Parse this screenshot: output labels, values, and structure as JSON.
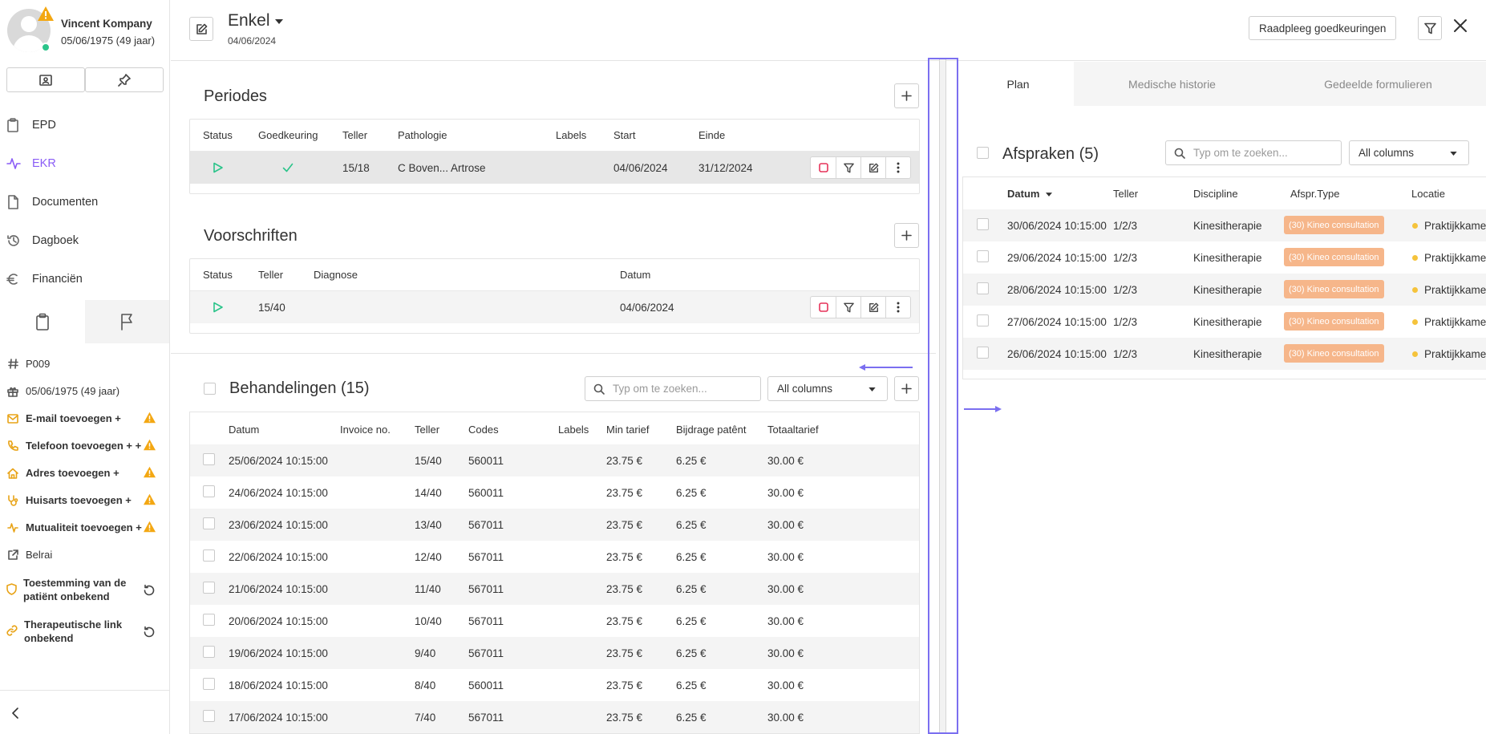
{
  "patient": {
    "name": "Vincent Kompany",
    "dob": "05/06/1975 (49 jaar)"
  },
  "nav": [
    {
      "label": "EPD",
      "icon": "clipboard-icon"
    },
    {
      "label": "EKR",
      "icon": "activity-icon"
    },
    {
      "label": "Documenten",
      "icon": "document-icon"
    },
    {
      "label": "Dagboek",
      "icon": "history-icon"
    },
    {
      "label": "Financiën",
      "icon": "euro-icon"
    }
  ],
  "info": [
    {
      "label": "P009",
      "icon": "hash-icon"
    },
    {
      "label": "05/06/1975 (49 jaar)",
      "icon": "gift-icon"
    },
    {
      "label": "E-mail toevoegen +",
      "icon": "mail-icon"
    },
    {
      "label": "Telefoon toevoegen + +",
      "icon": "phone-icon"
    },
    {
      "label": "Adres toevoegen +",
      "icon": "home-icon"
    },
    {
      "label": "Huisarts toevoegen +",
      "icon": "stethoscope-icon"
    },
    {
      "label": "Mutualiteit toevoegen +",
      "icon": "activity-icon"
    },
    {
      "label": "Belrai",
      "icon": "external-link-icon"
    },
    {
      "label": "Toestemming van de patiënt onbekend",
      "icon": "shield-icon"
    },
    {
      "label": "Therapeutische link onbekend",
      "icon": "link-icon"
    }
  ],
  "header": {
    "title": "Enkel",
    "date": "04/06/2024",
    "consult_button": "Raadpleeg goedkeuringen"
  },
  "periodes": {
    "title": "Periodes",
    "columns": [
      "Status",
      "Goedkeuring",
      "Teller",
      "Pathologie",
      "Labels",
      "Start",
      "Einde"
    ],
    "rows": [
      {
        "teller": "15/18",
        "pathologie": "C Boven... Artrose",
        "labels": "",
        "start": "04/06/2024",
        "einde": "31/12/2024"
      }
    ]
  },
  "voorschriften": {
    "title": "Voorschriften",
    "columns": [
      "Status",
      "Teller",
      "Diagnose",
      "Datum"
    ],
    "rows": [
      {
        "teller": "15/40",
        "diagnose": "",
        "datum": "04/06/2024"
      }
    ]
  },
  "behandelingen": {
    "title": "Behandelingen (15)",
    "search_placeholder": "Typ om te zoeken...",
    "filter_value": "All columns",
    "columns": [
      "Datum",
      "Invoice no.",
      "Teller",
      "Codes",
      "Labels",
      "Min tarief",
      "Bijdrage patênt",
      "Totaaltarief"
    ],
    "rows": [
      {
        "datum": "25/06/2024 10:15:00",
        "invoice": "",
        "teller": "15/40",
        "codes": "560011",
        "labels": "",
        "min": "23.75 €",
        "bijdrage": "6.25 €",
        "totaal": "30.00 €"
      },
      {
        "datum": "24/06/2024 10:15:00",
        "invoice": "",
        "teller": "14/40",
        "codes": "560011",
        "labels": "",
        "min": "23.75 €",
        "bijdrage": "6.25 €",
        "totaal": "30.00 €"
      },
      {
        "datum": "23/06/2024 10:15:00",
        "invoice": "",
        "teller": "13/40",
        "codes": "567011",
        "labels": "",
        "min": "23.75 €",
        "bijdrage": "6.25 €",
        "totaal": "30.00 €"
      },
      {
        "datum": "22/06/2024 10:15:00",
        "invoice": "",
        "teller": "12/40",
        "codes": "567011",
        "labels": "",
        "min": "23.75 €",
        "bijdrage": "6.25 €",
        "totaal": "30.00 €"
      },
      {
        "datum": "21/06/2024 10:15:00",
        "invoice": "",
        "teller": "11/40",
        "codes": "567011",
        "labels": "",
        "min": "23.75 €",
        "bijdrage": "6.25 €",
        "totaal": "30.00 €"
      },
      {
        "datum": "20/06/2024 10:15:00",
        "invoice": "",
        "teller": "10/40",
        "codes": "567011",
        "labels": "",
        "min": "23.75 €",
        "bijdrage": "6.25 €",
        "totaal": "30.00 €"
      },
      {
        "datum": "19/06/2024 10:15:00",
        "invoice": "",
        "teller": "9/40",
        "codes": "567011",
        "labels": "",
        "min": "23.75 €",
        "bijdrage": "6.25 €",
        "totaal": "30.00 €"
      },
      {
        "datum": "18/06/2024 10:15:00",
        "invoice": "",
        "teller": "8/40",
        "codes": "560011",
        "labels": "",
        "min": "23.75 €",
        "bijdrage": "6.25 €",
        "totaal": "30.00 €"
      },
      {
        "datum": "17/06/2024 10:15:00",
        "invoice": "",
        "teller": "7/40",
        "codes": "567011",
        "labels": "",
        "min": "23.75 €",
        "bijdrage": "6.25 €",
        "totaal": "30.00 €"
      }
    ]
  },
  "right_tabs": [
    "Plan",
    "Medische historie",
    "Gedeelde formulieren"
  ],
  "afspraken": {
    "title": "Afspraken (5)",
    "search_placeholder": "Typ om te zoeken...",
    "filter_value": "All columns",
    "columns": [
      "Datum",
      "Teller",
      "Discipline",
      "Afspr.Type",
      "Locatie"
    ],
    "rows": [
      {
        "datum": "30/06/2024 10:15:00",
        "teller": "1/2/3",
        "discipline": "Kinesitherapie",
        "type": "(30) Kineo consultation",
        "locatie": "Praktijkkamer"
      },
      {
        "datum": "29/06/2024 10:15:00",
        "teller": "1/2/3",
        "discipline": "Kinesitherapie",
        "type": "(30) Kineo consultation",
        "locatie": "Praktijkkamer"
      },
      {
        "datum": "28/06/2024 10:15:00",
        "teller": "1/2/3",
        "discipline": "Kinesitherapie",
        "type": "(30) Kineo consultation",
        "locatie": "Praktijkkamer"
      },
      {
        "datum": "27/06/2024 10:15:00",
        "teller": "1/2/3",
        "discipline": "Kinesitherapie",
        "type": "(30) Kineo consultation",
        "locatie": "Praktijkkamer"
      },
      {
        "datum": "26/06/2024 10:15:00",
        "teller": "1/2/3",
        "discipline": "Kinesitherapie",
        "type": "(30) Kineo consultation",
        "locatie": "Praktijkkamer"
      }
    ]
  },
  "colors": {
    "accent": "#8a5cf6",
    "success": "#2bc48a",
    "warning": "#e8a317",
    "badge": "#f6b68a",
    "stop": "#e6335a",
    "highlight": "#7b6ff0"
  }
}
